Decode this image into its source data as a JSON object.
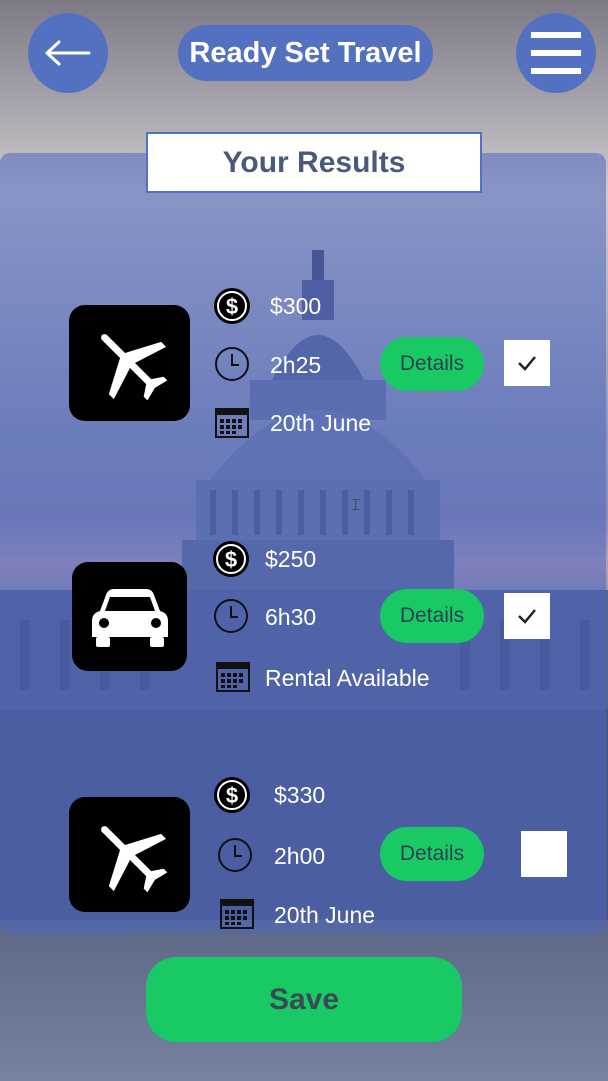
{
  "header": {
    "title": "Ready Set Travel",
    "back_icon": "arrow-left-icon",
    "menu_icon": "hamburger-menu-icon"
  },
  "results": {
    "heading": "Your Results",
    "items": [
      {
        "mode_icon": "airplane-icon",
        "price": "$300",
        "duration": "2h25",
        "date": "20th June",
        "details_label": "Details",
        "selected": true
      },
      {
        "mode_icon": "car-icon",
        "price": "$250",
        "duration": "6h30",
        "date": "Rental Available",
        "details_label": "Details",
        "selected": true
      },
      {
        "mode_icon": "airplane-icon",
        "price": "$330",
        "duration": "2h00",
        "date": "20th June",
        "details_label": "Details",
        "selected": false
      }
    ]
  },
  "footer": {
    "save_label": "Save"
  },
  "colors": {
    "brand_blue": "#5471c1",
    "accent_green": "#19c964"
  }
}
